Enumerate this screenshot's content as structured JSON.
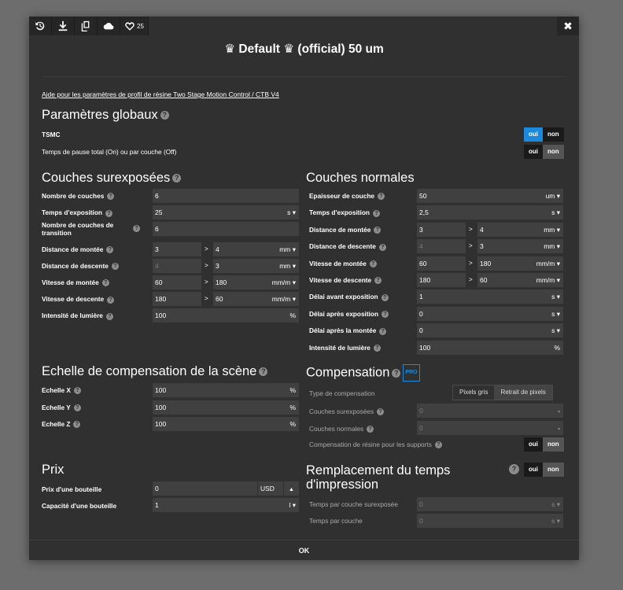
{
  "toolbar": {
    "likes": "25"
  },
  "title": "♛ Default ♛ (official) 50 um",
  "help_link": "Aide pour les paramètres de profil de résine Two Stage Motion Control / CTB V4",
  "global": {
    "heading": "Paramètres globaux",
    "tsmc_label": "TSMC",
    "pause_label": "Temps de pause total (On) ou par couche (Off)",
    "yes": "oui",
    "no": "non"
  },
  "overexposed": {
    "heading": "Couches surexposées",
    "rows": [
      {
        "label": "Nombre de couches",
        "value": "6"
      },
      {
        "label": "Temps d'exposition",
        "value": "25",
        "unit": "s ▾"
      },
      {
        "label": "Nombre de couches de transition",
        "value": "6"
      },
      {
        "label": "Distance de montée",
        "v1": "3",
        "v2": "4",
        "unit": "mm ▾"
      },
      {
        "label": "Distance de descente",
        "v1": "4",
        "v2": "3",
        "unit": "mm ▾"
      },
      {
        "label": "Vitesse de montée",
        "v1": "60",
        "v2": "180",
        "unit": "mm/m ▾"
      },
      {
        "label": "Vitesse de descente",
        "v1": "180",
        "v2": "60",
        "unit": "mm/m ▾"
      },
      {
        "label": "Intensité de lumière",
        "value": "100",
        "unit": "%"
      }
    ]
  },
  "normal": {
    "heading": "Couches normales",
    "rows": [
      {
        "label": "Epaisseur de couche",
        "value": "50",
        "unit": "um ▾"
      },
      {
        "label": "Temps d'exposition",
        "value": "2,5",
        "unit": "s ▾"
      },
      {
        "label": "Distance de montée",
        "v1": "3",
        "v2": "4",
        "unit": "mm ▾"
      },
      {
        "label": "Distance de descente",
        "v1": "4",
        "v2": "3",
        "unit": "mm ▾"
      },
      {
        "label": "Vitesse de montée",
        "v1": "60",
        "v2": "180",
        "unit": "mm/m ▾"
      },
      {
        "label": "Vitesse de descente",
        "v1": "180",
        "v2": "60",
        "unit": "mm/m ▾"
      },
      {
        "label": "Délai avant exposition",
        "value": "1",
        "unit": "s ▾"
      },
      {
        "label": "Délai après exposition",
        "value": "0",
        "unit": "s ▾"
      },
      {
        "label": "Délai après la montée",
        "value": "0",
        "unit": "s ▾"
      },
      {
        "label": "Intensité de lumière",
        "value": "100",
        "unit": "%"
      }
    ]
  },
  "scale": {
    "heading": "Echelle de compensation de la scène",
    "rows": [
      {
        "label": "Echelle X",
        "value": "100",
        "unit": "%"
      },
      {
        "label": "Echelle Y",
        "value": "100",
        "unit": "%"
      },
      {
        "label": "Echelle Z",
        "value": "100",
        "unit": "%"
      }
    ]
  },
  "compensation": {
    "heading": "Compensation",
    "pro": "PRO",
    "type_label": "Type de compensation",
    "opt1": "Pixels gris",
    "opt2": "Retrait de pixels",
    "over_label": "Couches surexposées",
    "over_value": "0",
    "normal_label": "Couches normales",
    "normal_value": "0",
    "support_label": "Compensation de résine pour les supports",
    "yes": "oui",
    "no": "non"
  },
  "price": {
    "heading": "Prix",
    "bottle_price_label": "Prix d'une bouteille",
    "bottle_price_value": "0",
    "currency": "USD",
    "capacity_label": "Capacité d'une bouteille",
    "capacity_value": "1",
    "capacity_unit": "l ▾"
  },
  "replace": {
    "heading": "Remplacement du temps d'impression",
    "yes": "oui",
    "no": "non",
    "over_label": "Temps par couche surexposée",
    "over_value": "0",
    "over_unit": "s ▾",
    "layer_label": "Temps par couche",
    "layer_value": "0",
    "layer_unit": "s ▾"
  },
  "footer": {
    "ok": "OK"
  }
}
